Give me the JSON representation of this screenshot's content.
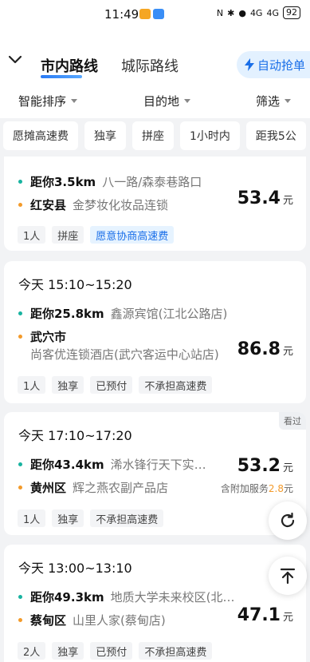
{
  "status_bar": {
    "time": "11:49",
    "battery": "92",
    "signal_a": "4G",
    "signal_b": "4G"
  },
  "header": {
    "tabs": [
      {
        "label": "市内路线",
        "active": true
      },
      {
        "label": "城际路线",
        "active": false
      }
    ],
    "auto_grab_label": "自动抢单"
  },
  "sort_bar": {
    "smart_sort": "智能排序",
    "destination": "目的地",
    "filter": "筛选"
  },
  "filter_chips": [
    "愿摊高速费",
    "独享",
    "拼座",
    "1小时内",
    "距我5公"
  ],
  "orders": [
    {
      "time": "",
      "pickup_distance": "距你3.5km",
      "pickup_place": "八一路/森泰巷路口",
      "dest_area": "红安县",
      "dest_place": "金梦妆化妆品连锁",
      "price": "53.4",
      "unit": "元",
      "tags": [
        "1人",
        "拼座",
        "愿意协商高速费"
      ],
      "seen": ""
    },
    {
      "time": "今天 15:10~15:20",
      "pickup_distance": "距你25.8km",
      "pickup_place": "鑫源宾馆(江北公路店)",
      "dest_area": "武穴市",
      "dest_place": "尚客优连锁酒店(武穴客运中心站店)",
      "price": "86.8",
      "unit": "元",
      "tags": [
        "1人",
        "独享",
        "已预付",
        "不承担高速费"
      ],
      "seen": ""
    },
    {
      "time": "今天 17:10~17:20",
      "pickup_distance": "距你43.4km",
      "pickup_place": "浠水锋行天下实…",
      "dest_area": "黄州区",
      "dest_place": "辉之燕农副产品店",
      "price": "53.2",
      "unit": "元",
      "extra_label": "含附加服务",
      "extra_value": "2.8",
      "extra_unit": "元",
      "tags": [
        "1人",
        "独享",
        "不承担高速费"
      ],
      "seen": "看过"
    },
    {
      "time": "今天 13:00~13:10",
      "pickup_distance": "距你49.3km",
      "pickup_place": "地质大学未来校区(北…",
      "dest_area": "蔡甸区",
      "dest_place": "山里人家(蔡甸店)",
      "price": "47.1",
      "unit": "元",
      "tags": [
        "2人",
        "独享",
        "已预付",
        "不承担高速费"
      ],
      "seen": ""
    }
  ],
  "colors": {
    "accent": "#1a6fe8",
    "pickup_dot": "#18b3a0",
    "dest_dot": "#f39a2a"
  },
  "icons": {
    "refresh": "refresh-icon",
    "scroll_top": "arrow-up-to-top-icon",
    "lightning": "lightning-icon",
    "back": "chevron-down-icon"
  }
}
